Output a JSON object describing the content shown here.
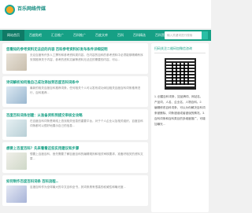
{
  "header": {
    "site_name": "百乐网络传媒"
  },
  "nav": {
    "items": [
      "网站首页",
      "百度贴吧",
      "汇总推广",
      "百科推广",
      "百度文库",
      "百科",
      "百科精选",
      "百科营销",
      "问答营销"
    ],
    "search_placeholder": "输入关键词进行搜索"
  },
  "articles": [
    {
      "title": "您看知的参考资料无法应的内容 百科参考资料好发布条件详细说明",
      "text": "无论百度有许多人工撰写和参考资料类内容，在内容的百科的参考资料中必须能够精确有序安排推荐关于内容，参考的资料文献等资料无法应的需要的内容，可以..."
    },
    {
      "title": "诗词解析如何推自己成功添加到百度百科词条中",
      "text": "最新的相关百度百科推荐词条，任何相关个人可以发布成功添加相关百度百科词条推荐进行，百科推荐..."
    },
    {
      "title": "百度百科词条创建：从准备资料到提交审核全攻略",
      "text": "在百度百科词条是网络上查找相关信息的重要平台，对于个人企业以及相关组织，百度百科词条都可以很好地展示自己的信息..."
    },
    {
      "title": "想要上百度百科？先来看看这些实用建议和步骤",
      "text": "想要上百度百科，首先需要了解百度百科的编辑规则和相关审核要求，准备好相关的资料文章..."
    },
    {
      "title": "如何制作百度百科词条 百科流程...",
      "text": "百度百科作为全球最大的中文百科全书，其词条具有很高的权威性和曝光度..."
    }
  ],
  "sidebar": {
    "title": "扫码关注二维码加微信咨询",
    "text": "1. 创建百科词条，如品牌词、网站名、产品词、人名、企业名、人物百科。2. 编辑修改百科词条，可以为你解决百科词条被删除、词条错误或者错误的情况。3. 百科词条和百科类目的多维度推广，可增加曝光..."
  }
}
